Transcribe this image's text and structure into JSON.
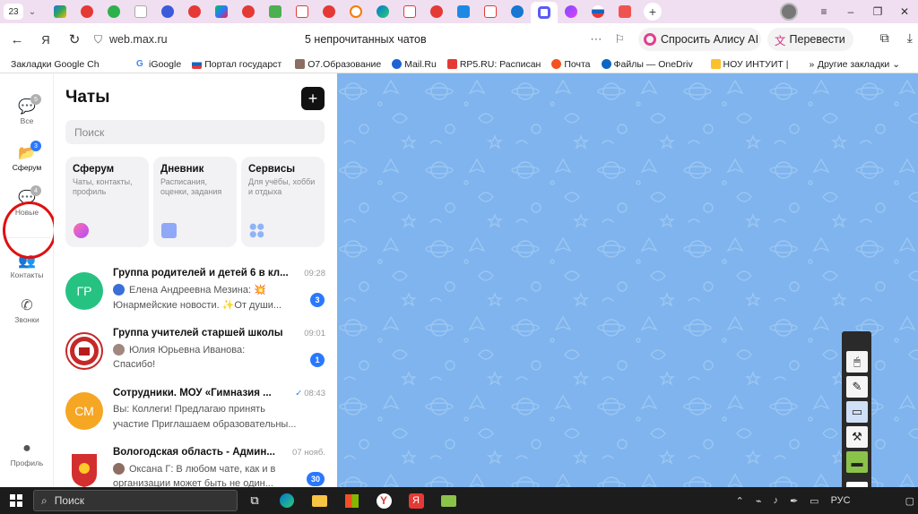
{
  "browser": {
    "tab_count": "23",
    "url": "web.max.ru",
    "page_title": "5 непрочитанных чатов",
    "alice_label": "Спросить Алису AI",
    "translate_label": "Перевести"
  },
  "bookmarks": {
    "items": [
      "Закладки Google Ch",
      "iGoogle",
      "Портал государст",
      "О7.Образование",
      "Mail.Ru",
      "RP5.RU: Расписан",
      "Почта",
      "Файлы — OneDriv",
      "НОУ ИНТУИТ |"
    ],
    "more_label": "Другие закладки"
  },
  "nav": {
    "all": "Все",
    "all_badge": "5",
    "sferum": "Сферум",
    "sferum_badge": "3",
    "new": "Новые",
    "new_badge": "4",
    "contacts": "Контакты",
    "calls": "Звонки",
    "profile": "Профиль"
  },
  "chats": {
    "heading": "Чаты",
    "search_placeholder": "Поиск",
    "cards": [
      {
        "title": "Сферум",
        "subtitle": "Чаты, контакты, профиль"
      },
      {
        "title": "Дневник",
        "subtitle": "Расписания, оценки, задания"
      },
      {
        "title": "Сервисы",
        "subtitle": "Для учёбы, хобби и отдыха"
      }
    ],
    "list": [
      {
        "initials": "ГР",
        "name": "Группа родителей и детей 6 в кл...",
        "time": "09:28",
        "sender": "Елена Андреевна Мезина: 💥",
        "preview": "Юнармейские новости. ✨От души...",
        "badge": "3"
      },
      {
        "initials": "",
        "name": "Группа учителей старшей школы",
        "time": "09:01",
        "sender": "Юлия Юрьевна Иванова:",
        "preview": "Спасибо!",
        "badge": "1"
      },
      {
        "initials": "СМ",
        "name": "Сотрудники. МОУ «Гимназия ...",
        "time": "08:43",
        "sender": "Вы: Коллеги! Предлагаю принять",
        "preview": "участие Приглашаем образовательны...",
        "badge": ""
      },
      {
        "initials": "",
        "name": "Вологодская область - Админ...",
        "time": "07 нояб.",
        "sender": "Оксана Г: В любом чате, как и в",
        "preview": "организации может быть не один...",
        "badge": "30"
      }
    ]
  },
  "taskbar": {
    "search_label": "Поиск",
    "lang": "РУС"
  }
}
